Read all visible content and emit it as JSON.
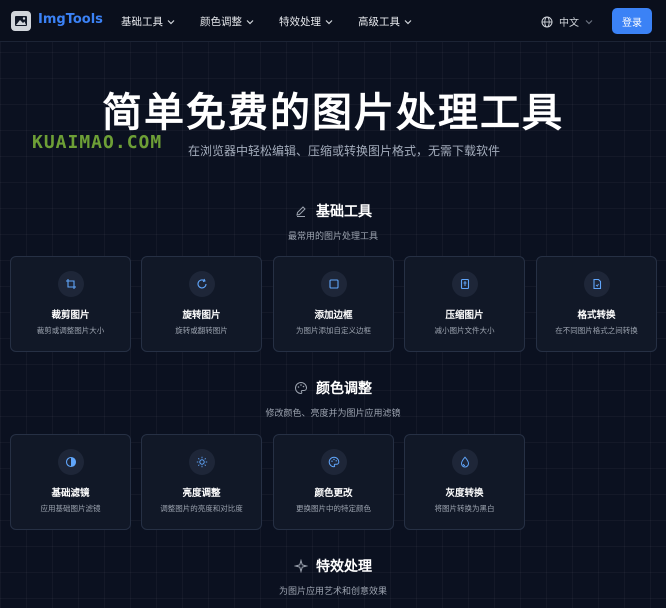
{
  "app": {
    "name": "ImgTools",
    "accent": "#3b82f6"
  },
  "nav": {
    "menu": [
      {
        "label": "基础工具"
      },
      {
        "label": "颜色调整"
      },
      {
        "label": "特效处理"
      },
      {
        "label": "高级工具"
      }
    ],
    "language": "中文",
    "login_label": "登录"
  },
  "hero": {
    "title": "简单免费的图片处理工具",
    "subtitle": "在浏览器中轻松编辑、压缩或转换图片格式，无需下载软件",
    "watermark": "KUAIMAO.COM"
  },
  "sections": [
    {
      "title": "基础工具",
      "description": "最常用的图片处理工具",
      "icon": "edit-icon",
      "tools": [
        {
          "name": "裁剪图片",
          "desc": "裁剪或调整图片大小",
          "icon": "crop-icon"
        },
        {
          "name": "旋转图片",
          "desc": "旋转或翻转图片",
          "icon": "rotate-icon"
        },
        {
          "name": "添加边框",
          "desc": "为图片添加自定义边框",
          "icon": "border-icon"
        },
        {
          "name": "压缩图片",
          "desc": "减小图片文件大小",
          "icon": "compress-icon"
        },
        {
          "name": "格式转换",
          "desc": "在不同图片格式之间转换",
          "icon": "file-convert-icon"
        }
      ]
    },
    {
      "title": "颜色调整",
      "description": "修改颜色、亮度并为图片应用滤镜",
      "icon": "palette-icon",
      "tools": [
        {
          "name": "基础滤镜",
          "desc": "应用基础图片滤镜",
          "icon": "contrast-icon"
        },
        {
          "name": "亮度调整",
          "desc": "调整图片的亮度和对比度",
          "icon": "sun-icon"
        },
        {
          "name": "颜色更改",
          "desc": "更换图片中的特定颜色",
          "icon": "palette-icon"
        },
        {
          "name": "灰度转换",
          "desc": "将图片转换为黑白",
          "icon": "droplet-icon"
        }
      ]
    },
    {
      "title": "特效处理",
      "description": "为图片应用艺术和创意效果",
      "icon": "sparkle-icon",
      "tools": []
    }
  ]
}
